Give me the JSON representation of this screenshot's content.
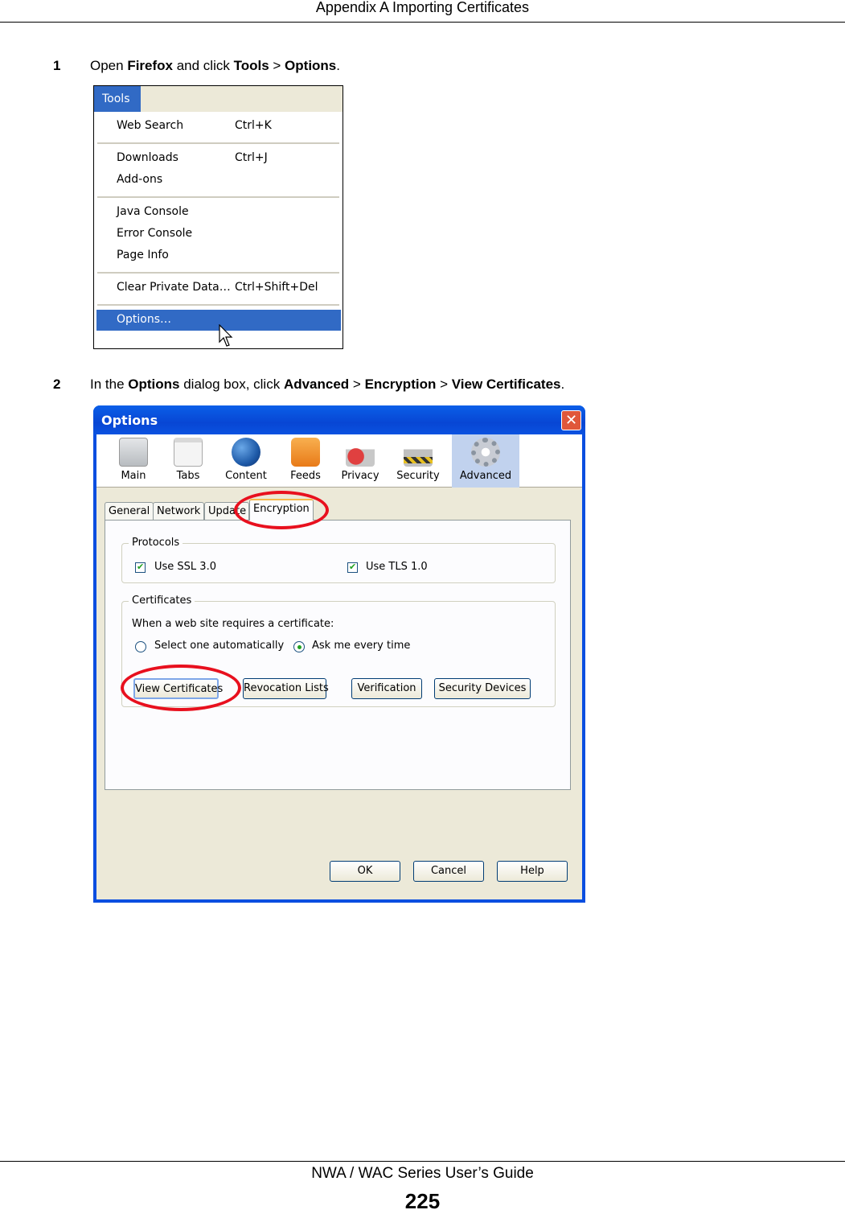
{
  "header": {
    "title": "Appendix A Importing Certificates"
  },
  "footer": {
    "guide": "NWA / WAC Series User’s Guide",
    "page_number": "225"
  },
  "steps": [
    {
      "number": "1",
      "parts": [
        "Open ",
        "Firefox",
        " and click ",
        "Tools",
        " > ",
        "Options",
        "."
      ]
    },
    {
      "number": "2",
      "parts": [
        "In the ",
        "Options",
        " dialog box, click ",
        "Advanced",
        " > ",
        "Encryption",
        " > ",
        "View Certificates",
        "."
      ]
    }
  ],
  "tools_menu": {
    "menu_label": "Tools",
    "items": [
      {
        "label": "Web Search",
        "shortcut": "Ctrl+K"
      },
      {
        "label": "Downloads",
        "shortcut": "Ctrl+J"
      },
      {
        "label": "Add-ons",
        "shortcut": ""
      },
      {
        "label": "Java Console",
        "shortcut": ""
      },
      {
        "label": "Error Console",
        "shortcut": ""
      },
      {
        "label": "Page Info",
        "shortcut": ""
      },
      {
        "label": "Clear Private Data…",
        "shortcut": "Ctrl+Shift+Del"
      },
      {
        "label": "Options…",
        "shortcut": "",
        "highlighted": true
      }
    ]
  },
  "options_dialog": {
    "title": "Options",
    "close_icon": "close-icon",
    "toolbar": [
      {
        "label": "Main",
        "icon": "main-switch-icon",
        "color": "#b8bcc0"
      },
      {
        "label": "Tabs",
        "icon": "tabs-window-icon",
        "color": "#e8e8e8"
      },
      {
        "label": "Content",
        "icon": "globe-icon",
        "color": "#1e5aa8"
      },
      {
        "label": "Feeds",
        "icon": "rss-feed-icon",
        "color": "#f08a24"
      },
      {
        "label": "Privacy",
        "icon": "unlocked-padlock-icon",
        "color": "#d83a3a"
      },
      {
        "label": "Security",
        "icon": "padlock-icon",
        "color": "#b0b0b0"
      },
      {
        "label": "Advanced",
        "icon": "gear-icon",
        "color": "#9aa4b0",
        "active": true
      }
    ],
    "tabs": [
      {
        "label": "General"
      },
      {
        "label": "Network"
      },
      {
        "label": "Update"
      },
      {
        "label": "Encryption",
        "selected": true
      }
    ],
    "protocols": {
      "legend": "Protocols",
      "ssl_label": "Use SSL 3.0",
      "ssl_checked": true,
      "tls_label": "Use TLS 1.0",
      "tls_checked": true
    },
    "certificates": {
      "legend": "Certificates",
      "prompt": "When a web site requires a certificate:",
      "radio_auto": "Select one automatically",
      "radio_ask": "Ask me every time",
      "selected_radio": "Ask me every time",
      "buttons": [
        "View Certificates",
        "Revocation Lists",
        "Verification",
        "Security Devices"
      ]
    },
    "footer_buttons": [
      "OK",
      "Cancel",
      "Help"
    ],
    "annotation_color": "#e8101e"
  }
}
